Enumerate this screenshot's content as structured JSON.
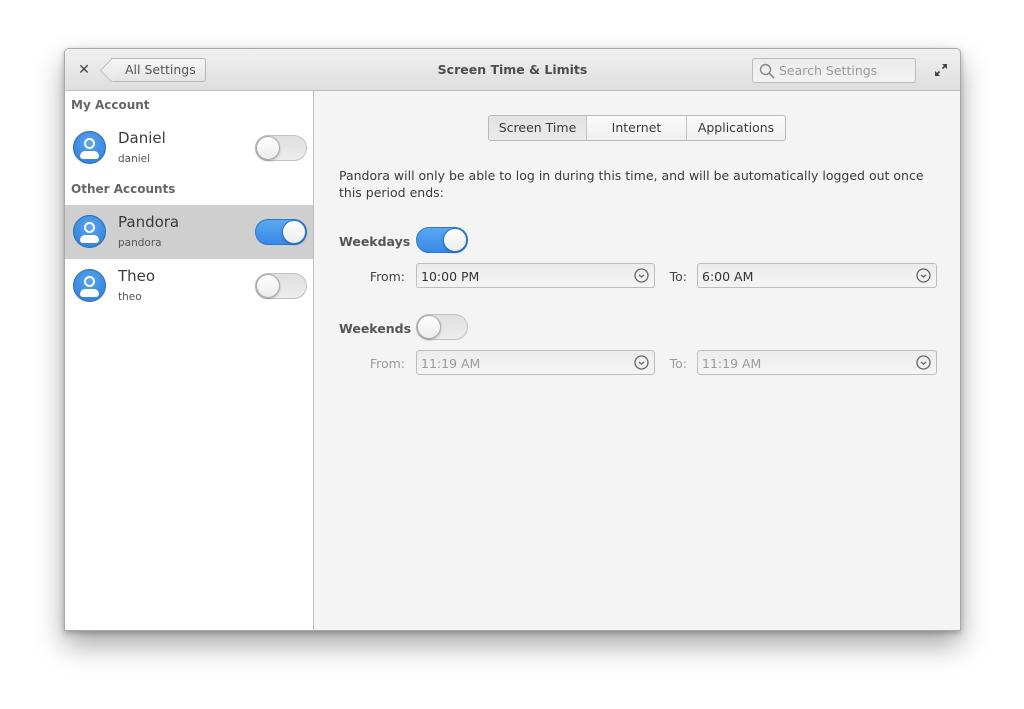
{
  "window": {
    "title": "Screen Time & Limits",
    "back_label": "All Settings",
    "search_placeholder": "Search Settings",
    "close_icon": "close-icon",
    "maximize_icon": "maximize-icon"
  },
  "sidebar": {
    "my_account_header": "My Account",
    "other_accounts_header": "Other Accounts",
    "accounts": [
      {
        "name": "Daniel",
        "username": "daniel",
        "enabled": false,
        "selected": false
      },
      {
        "name": "Pandora",
        "username": "pandora",
        "enabled": true,
        "selected": true
      },
      {
        "name": "Theo",
        "username": "theo",
        "enabled": false,
        "selected": false
      }
    ]
  },
  "tabs": [
    {
      "label": "Screen Time",
      "active": true
    },
    {
      "label": "Internet",
      "active": false
    },
    {
      "label": "Applications",
      "active": false
    }
  ],
  "screen_time": {
    "description": "Pandora will only be able to log in during this time, and will be automatically logged out once this period ends:",
    "weekdays": {
      "label": "Weekdays",
      "enabled": true,
      "from_label": "From:",
      "from_value": "10:00 PM",
      "to_label": "To:",
      "to_value": "6:00 AM"
    },
    "weekends": {
      "label": "Weekends",
      "enabled": false,
      "from_label": "From:",
      "from_value": "11:19 AM",
      "to_label": "To:",
      "to_value": "11:19 AM"
    }
  },
  "colors": {
    "accent": "#3689e6",
    "selected_row": "#cfcfcf"
  }
}
